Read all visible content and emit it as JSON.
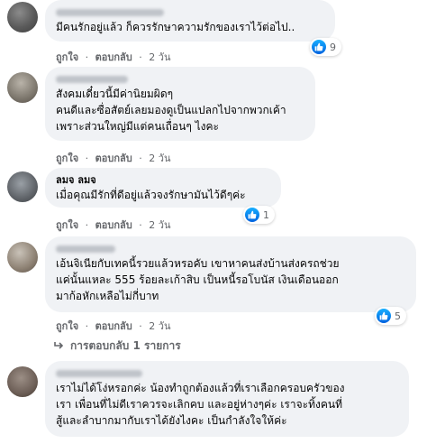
{
  "comments": [
    {
      "text": "มีคนรักอยู่แล้ว ก็ควรรักษาความรักของเราไว้ต่อไป..",
      "actions": {
        "like": "ถูกใจ",
        "reply": "ตอบกลับ",
        "time": "2 วัน"
      },
      "reaction_count": "9"
    },
    {
      "text": "สังคมเดี๋ยวนี้มีค่านิยมผิดๆ\nคนดีและซื่อสัตย์เลยมองดูเป็นแปลกไปจากพวกเค้า\nเพราะส่วนใหญ่มีแต่คนเถื่อนๆ ไงคะ",
      "actions": {
        "like": "ถูกใจ",
        "reply": "ตอบกลับ",
        "time": "2 วัน"
      }
    },
    {
      "author": "ลมจ ลมจ",
      "text": "เมื่อคุณมีรักที่ดีอยู่แล้วจงรักษามันไว้ดีๆค่ะ",
      "actions": {
        "like": "ถูกใจ",
        "reply": "ตอบกลับ",
        "time": "2 วัน"
      },
      "reaction_count": "1"
    },
    {
      "text": "เอ้นจิเนียกับเทคนี้รวยแล้วหรอคับ เขาหาคนส่งบ้านส่งครถช่วย\nแค่นั้นแหละ 555 ร้อยละเก้าสิบ เป็นหนี้รอโบนัส เงินเดือนออก\nมาก้อหักเหลือไม่กี่บาท",
      "actions": {
        "like": "ถูกใจ",
        "reply": "ตอบกลับ",
        "time": "2 วัน"
      },
      "reaction_count": "5",
      "replies_label": "การตอบกลับ 1 รายการ"
    },
    {
      "text": "เราไม่ได้โง่หรอกค่ะ น้องทำถูกต้องแล้วที่เราเลือกครอบครัวของ\nเรา เพื่อนที่ไม่ดีเราควรจะเลิกคบ และอยู่ห่างๆค่ะ เราจะทิ้งคนที่\nสู้และลำบากมากับเราได้ยังไงคะ เป็นกำลังใจให้ค่ะ"
    }
  ],
  "colors": {
    "bubble": "#f0f2f5",
    "meta": "#65676b",
    "like_blue": "#0062df"
  },
  "icons": {
    "like": "thumbs-up-icon",
    "reply": "reply-arrow-icon"
  }
}
